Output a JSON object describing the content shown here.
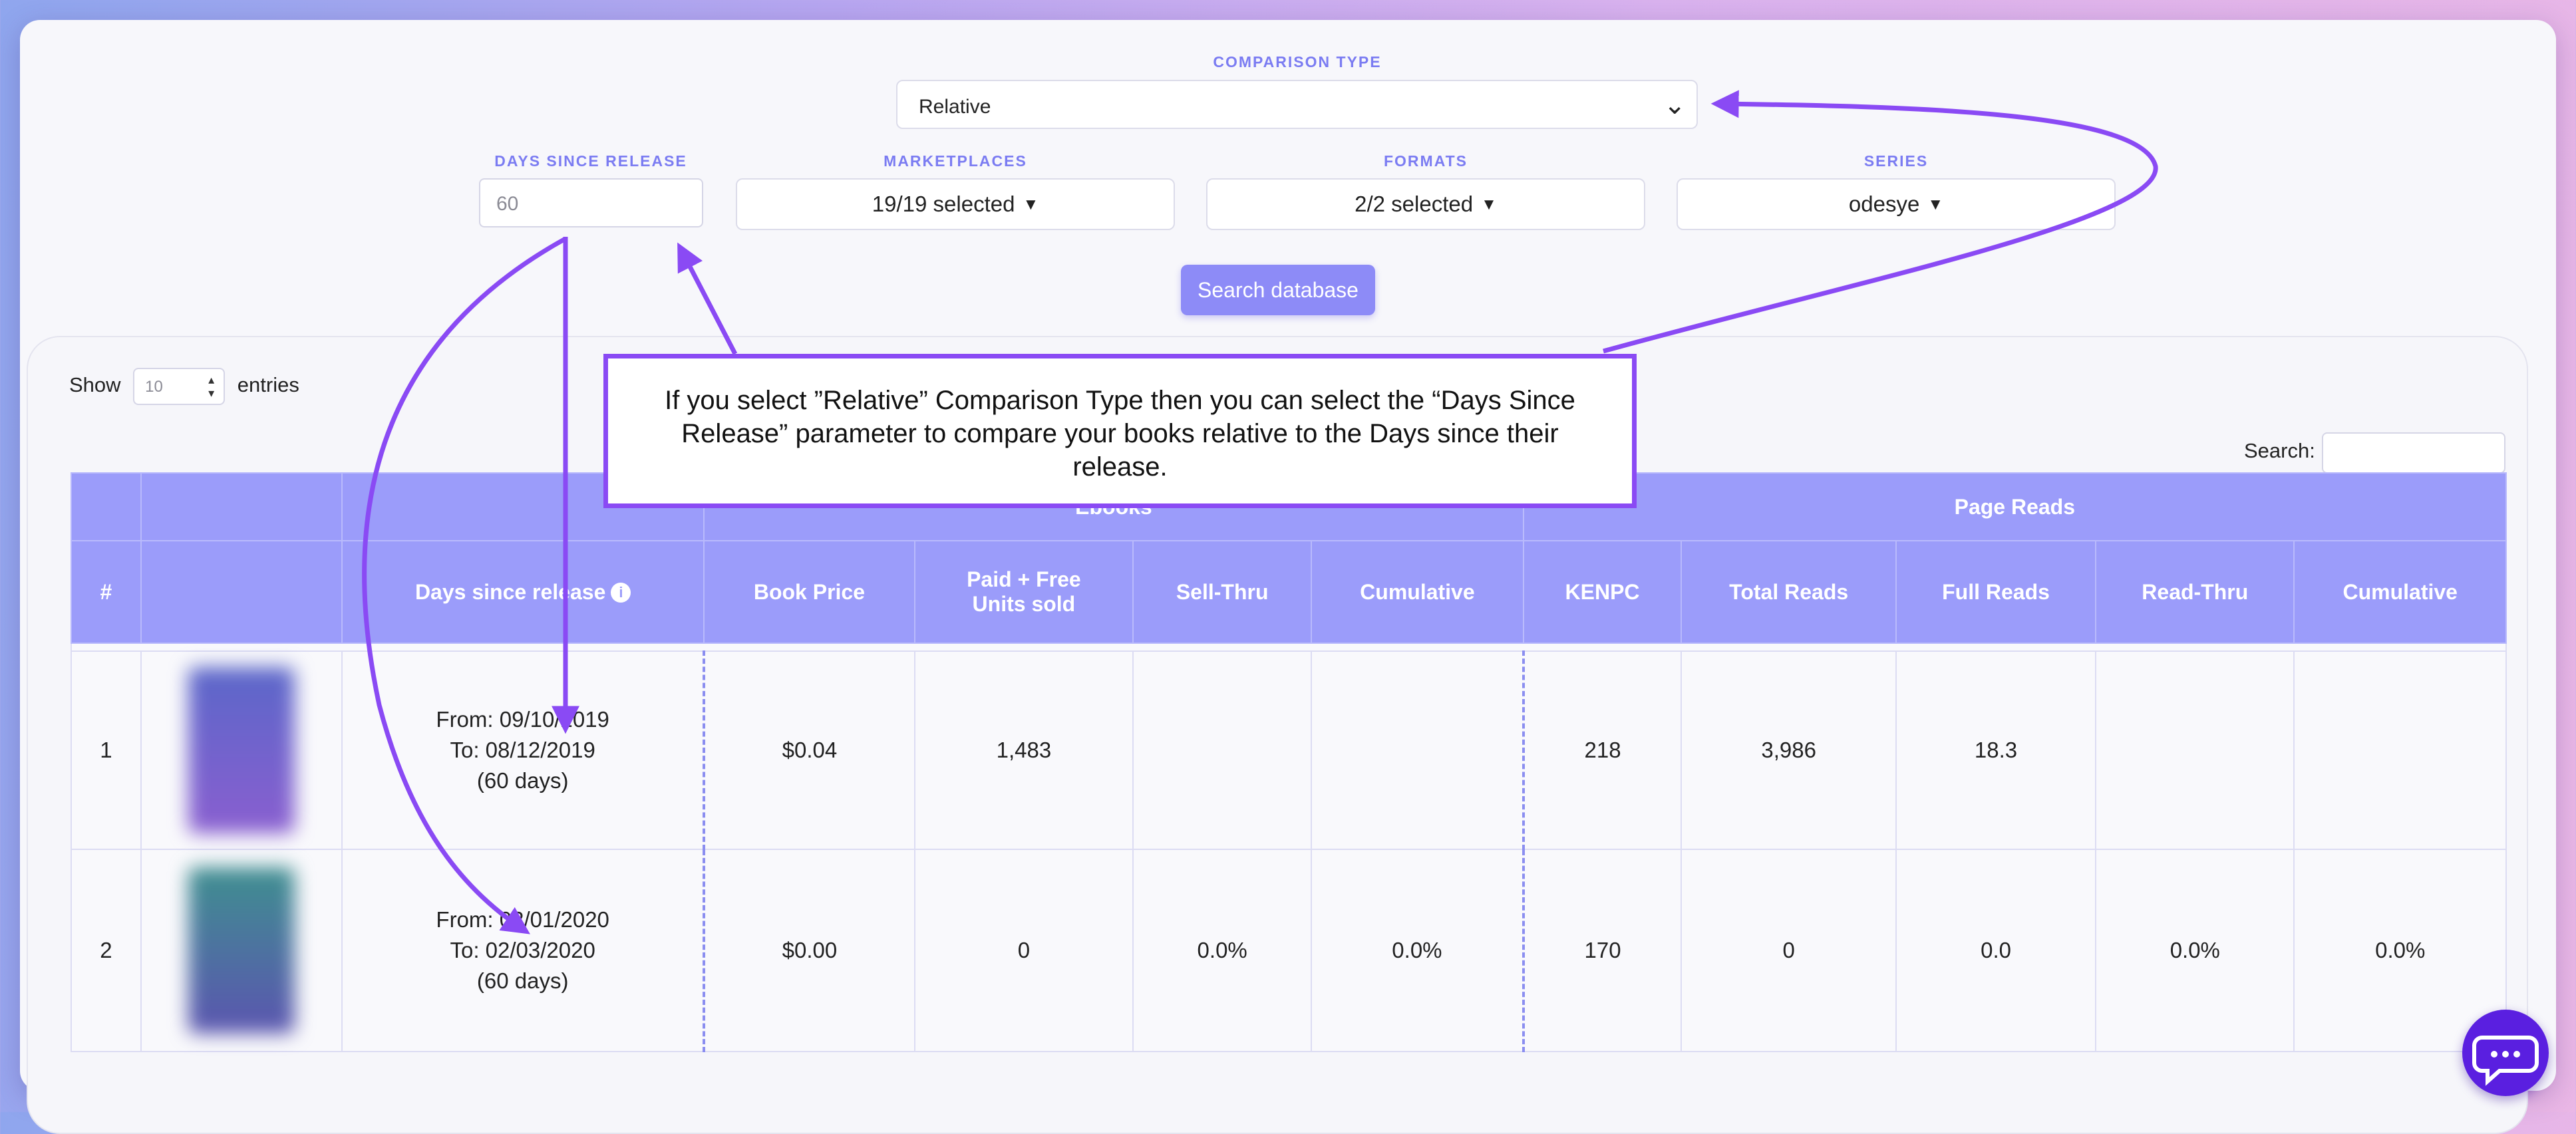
{
  "filters": {
    "comparison_type_label": "COMPARISON TYPE",
    "comparison_type_value": "Relative",
    "days_label": "DAYS SINCE RELEASE",
    "days_value": "60",
    "marketplaces_label": "MARKETPLACES",
    "marketplaces_value": "19/19 selected",
    "formats_label": "FORMATS",
    "formats_value": "2/2 selected",
    "series_label": "SERIES",
    "series_value": "odesye",
    "search_button": "Search database"
  },
  "table_controls": {
    "show_label": "Show",
    "entries_value": "10",
    "entries_label": "entries",
    "search_label": "Search:"
  },
  "table": {
    "group_headers": {
      "ebooks": "Ebooks",
      "page_reads": "Page Reads"
    },
    "columns": {
      "num": "#",
      "days": "Days since release",
      "book_price": "Book Price",
      "units_line1": "Paid + Free",
      "units_line2": "Units sold",
      "sell_thru": "Sell-Thru",
      "cumulative_e": "Cumulative",
      "kenpc": "KENPC",
      "total_reads": "Total Reads",
      "full_reads": "Full Reads",
      "read_thru": "Read-Thru",
      "cumulative_p": "Cumulative"
    },
    "rows": [
      {
        "num": "1",
        "from": "From: 09/10/2019",
        "to": "To: 08/12/2019",
        "days": "(60 days)",
        "price": "$0.04",
        "units": "1,483",
        "sell_thru": "",
        "cumulative_e": "",
        "kenpc": "218",
        "total_reads": "3,986",
        "full_reads": "18.3",
        "read_thru": "",
        "cumulative_p": "",
        "cover_colors": [
          "#5b67c9",
          "#8a5fd0"
        ]
      },
      {
        "num": "2",
        "from": "From: 02/01/2020",
        "to": "To: 02/03/2020",
        "days": "(60 days)",
        "price": "$0.00",
        "units": "0",
        "sell_thru": "0.0%",
        "cumulative_e": "0.0%",
        "kenpc": "170",
        "total_reads": "0",
        "full_reads": "0.0",
        "read_thru": "0.0%",
        "cumulative_p": "0.0%",
        "cover_colors": [
          "#3f8f90",
          "#5b55b0"
        ]
      }
    ]
  },
  "callout": {
    "text": "If you select ”Relative” Comparison Type then you can select the “Days Since Release” parameter to compare your books relative to the   Days since their release."
  },
  "colors": {
    "accent": "#9b9cfa",
    "annotation": "#8a4af4",
    "chat": "#5a1fe0"
  },
  "icons": {
    "info": "info-icon",
    "chat": "chat-bubble-icon",
    "chevron": "chevron-down-icon",
    "caret": "caret-down-icon"
  }
}
